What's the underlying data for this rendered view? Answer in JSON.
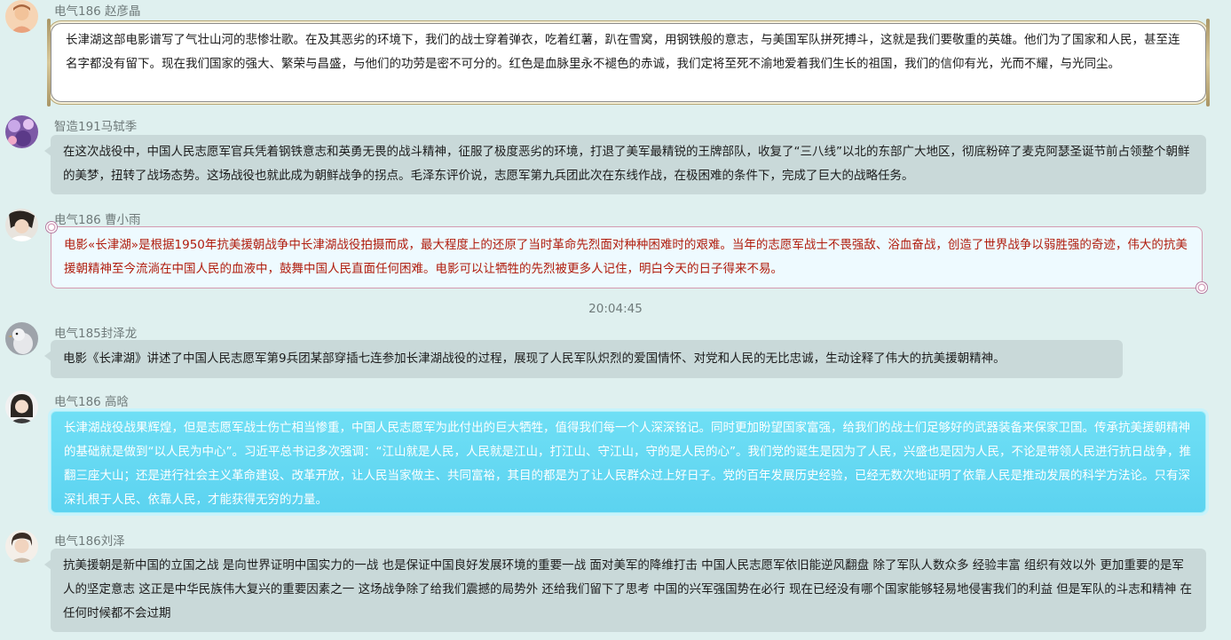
{
  "messages": [
    {
      "sender": "电气186 赵彦晶",
      "text": "长津湖这部电影谱写了气壮山河的悲惨壮歌。在及其恶劣的环境下，我们的战士穿着弹衣，吃着红薯，趴在雪窝，用钢铁般的意志，与美国军队拼死搏斗，这就是我们要敬重的英雄。他们为了国家和人民，甚至连名字都没有留下。现在我们国家的强大、繁荣与昌盛，与他们的功劳是密不可分的。红色是血脉里永不褪色的赤诚，我们定将至死不渝地爱着我们生长的祖国，我们的信仰有光，光而不耀，与光同尘。"
    },
    {
      "sender": "智造191马轼季",
      "text": "在这次战役中，中国人民志愿军官兵凭着钢铁意志和英勇无畏的战斗精神，征服了极度恶劣的环境，打退了美军最精锐的王牌部队，收复了“三八线”以北的东部广大地区，彻底粉碎了麦克阿瑟圣诞节前占领整个朝鲜的美梦，扭转了战场态势。这场战役也就此成为朝鲜战争的拐点。毛泽东评价说，志愿军第九兵团此次在东线作战，在极困难的条件下，完成了巨大的战略任务。"
    },
    {
      "sender": "电气186 曹小雨",
      "text": "电影«长津湖»是根据1950年抗美援朝战争中长津湖战役拍摄而成，最大程度上的还原了当时革命先烈面对种种困难时的艰难。当年的志愿军战士不畏强敌、浴血奋战，创造了世界战争以弱胜强的奇迹，伟大的抗美援朝精神至今流淌在中国人民的血液中，鼓舞中国人民直面任何困难。电影可以让牺牲的先烈被更多人记住，明白今天的日子得来不易。"
    },
    {
      "sender": "电气185封泽龙",
      "text": "电影《长津湖》讲述了中国人民志愿军第9兵团某部穿插七连参加长津湖战役的过程，展现了人民军队炽烈的爱国情怀、对党和人民的无比忠诚，生动诠释了伟大的抗美援朝精神。"
    },
    {
      "sender": "电气186  高晗",
      "text": "长津湖战役战果辉煌，但是志愿军战士伤亡相当惨重，中国人民志愿军为此付出的巨大牺牲，值得我们每一个人深深铭记。同时更加盼望国家富强，给我们的战士们足够好的武器装备来保家卫国。传承抗美援朝精神的基础就是做到“以人民为中心”。习近平总书记多次强调：“江山就是人民，人民就是江山，打江山、守江山，守的是人民的心”。我们党的诞生是因为了人民，兴盛也是因为人民，不论是带领人民进行抗日战争，推翻三座大山；还是进行社会主义革命建设、改革开放，让人民当家做主、共同富裕，其目的都是为了让人民群众过上好日子。党的百年发展历史经验，已经无数次地证明了依靠人民是推动发展的科学方法论。只有深深扎根于人民、依靠人民，才能获得无穷的力量。"
    },
    {
      "sender": "电气186刘泽",
      "text": "抗美援朝是新中国的立国之战 是向世界证明中国实力的一战 也是保证中国良好发展环境的重要一战 面对美军的降维打击 中国人民志愿军依旧能逆风翻盘 除了军队人数众多 经验丰富 组织有效以外 更加重要的是军人的坚定意志 这正是中华民族伟大复兴的重要因素之一 这场战争除了给我们震撼的局势外 还给我们留下了思考 中国的兴军强国势在必行 现在已经没有哪个国家能够轻易地侵害我们的利益 但是军队的斗志和精神 在任何时候都不会过期"
    }
  ],
  "timestamp": "20:04:45"
}
